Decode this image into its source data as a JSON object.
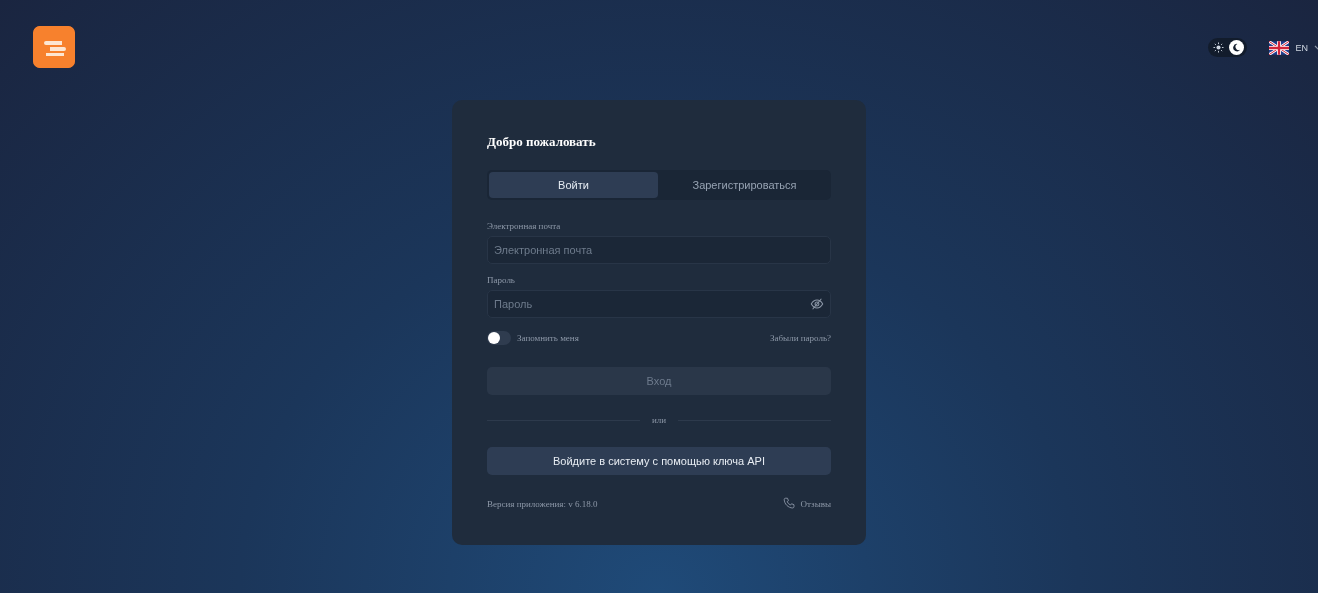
{
  "header": {
    "theme_toggle": {
      "dark": true
    },
    "language": {
      "code": "EN"
    }
  },
  "card": {
    "title": "Добро пожаловать",
    "tabs": [
      {
        "label": "Войти",
        "selected": true
      },
      {
        "label": "Зарегистрироваться",
        "selected": false
      }
    ],
    "fields": [
      {
        "label": "Электронная почта",
        "placeholder": "Электронная почта",
        "kind": "text"
      },
      {
        "label": "Пароль",
        "placeholder": "Пароль",
        "kind": "password"
      }
    ],
    "remember": {
      "label": "Запомнить меня",
      "on": false
    },
    "forgot_link": "Забыли пароль?",
    "login_button": {
      "label": "Вход",
      "disabled": true
    },
    "divider_text": "или",
    "api_button": "Войдите в систему с помощью ключа API",
    "version": "Версия приложения: v 6.18.0",
    "feedback_link": "Отзывы"
  }
}
